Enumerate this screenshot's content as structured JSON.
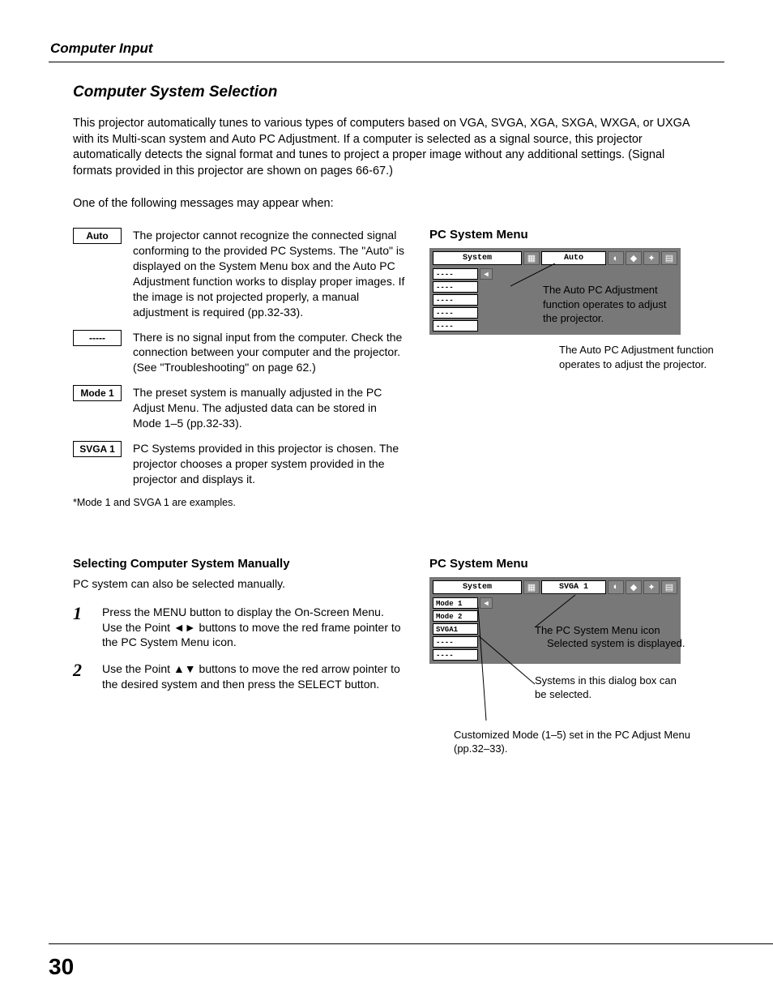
{
  "header": {
    "section": "Computer Input"
  },
  "title": "Computer System Selection",
  "intro": "This projector automatically tunes to various types of computers based on VGA, SVGA, XGA, SXGA, WXGA, or UXGA with its Multi-scan system and Auto PC Adjustment. If a computer is selected as a signal source, this projector automatically detects the signal format and tunes to project a proper image without any additional settings. (Signal formats provided in this projector are shown on pages 66-67.)",
  "lead": "One of the following messages may appear when:",
  "messages": [
    {
      "tag": "Auto",
      "text": "The projector cannot recognize the connected signal conforming to the provided PC Systems. The \"Auto\" is displayed on the System Menu box and the Auto PC Adjustment function works to display proper images. If the image is not projected properly, a manual adjustment is required (pp.32-33)."
    },
    {
      "tag": "-----",
      "text": "There is no signal input from the computer. Check the connection between your computer and the projector. (See \"Troubleshooting\" on page 62.)"
    },
    {
      "tag": "Mode 1",
      "text": "The preset system is manually adjusted in the PC Adjust Menu. The adjusted data can be stored in Mode 1–5 (pp.32-33)."
    },
    {
      "tag": "SVGA 1",
      "text": "PC Systems provided in this projector is chosen. The projector chooses a proper system provided in the projector and displays it."
    }
  ],
  "footnote": "*Mode 1 and SVGA 1 are examples.",
  "menu1": {
    "heading": "PC System Menu",
    "system_label": "System",
    "selected": "Auto",
    "items": [
      "----",
      "----",
      "----",
      "----",
      "----"
    ],
    "annotation": "The Auto PC Adjustment function operates to adjust the projector."
  },
  "manual": {
    "heading": "Selecting Computer System Manually",
    "intro": "PC system can also be selected manually.",
    "steps": [
      {
        "n": "1",
        "text_a": "Press the MENU button to display the On-Screen Menu. Use the Point ",
        "text_b": " buttons to move the red frame pointer to the PC System Menu icon."
      },
      {
        "n": "2",
        "text_a": "Use the Point ",
        "text_b": " buttons to move the red arrow pointer to the desired system and then press the SELECT button."
      }
    ]
  },
  "menu2": {
    "heading": "PC System Menu",
    "system_label": "System",
    "selected": "SVGA 1",
    "items": [
      "Mode 1",
      "Mode 2",
      "SVGA1",
      "----",
      "----"
    ],
    "annot1a": "The PC System Menu icon",
    "annot1b": "Selected system is displayed.",
    "annot2": "Systems in this dialog box can be selected.",
    "caption": "Customized Mode (1–5) set in the PC Adjust Menu (pp.32–33)."
  },
  "page_number": "30"
}
